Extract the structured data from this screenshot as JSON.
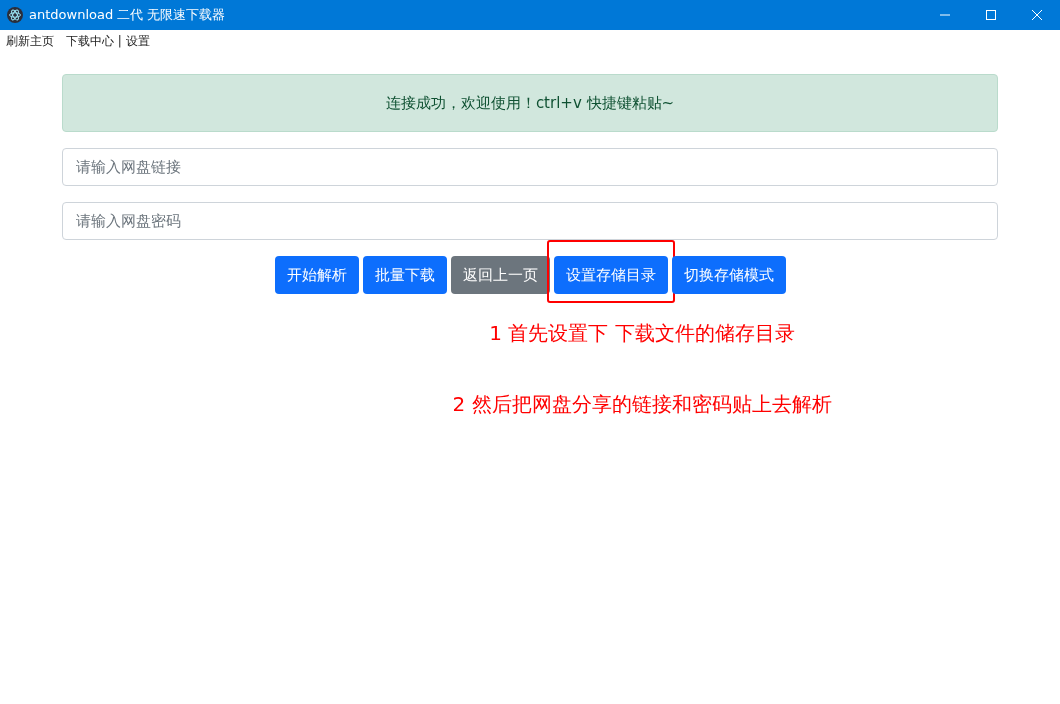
{
  "window": {
    "title": "antdownload 二代 无限速下载器"
  },
  "menu": [
    "刷新主页",
    "下载中心 | 设置"
  ],
  "alert": {
    "text": "连接成功，欢迎使用！ctrl+v 快捷键粘贴~"
  },
  "fields": [
    {
      "placeholder": "请输入网盘链接"
    },
    {
      "placeholder": "请输入网盘密码"
    }
  ],
  "buttons": [
    {
      "label": "开始解析",
      "kind": "primary",
      "highlighted": false
    },
    {
      "label": "批量下载",
      "kind": "primary",
      "highlighted": false
    },
    {
      "label": "返回上一页",
      "kind": "secondary",
      "highlighted": false
    },
    {
      "label": "设置存储目录",
      "kind": "primary",
      "highlighted": true
    },
    {
      "label": "切换存储模式",
      "kind": "primary",
      "highlighted": false
    }
  ],
  "notes": [
    "1 首先设置下 下载文件的储存目录",
    "2 然后把网盘分享的链接和密码贴上去解析"
  ]
}
